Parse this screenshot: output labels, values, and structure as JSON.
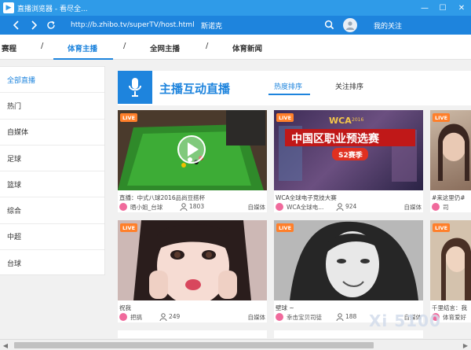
{
  "window": {
    "title": "直播浏览器 - 看尽全..."
  },
  "nav": {
    "url": "http://b.zhibo.tv/superTV/host.html",
    "username": "斯诺克",
    "my_follow": "我的关注"
  },
  "category_tabs": [
    "赛程",
    "体育主播",
    "全网主播",
    "体育新闻"
  ],
  "category_separator": "/",
  "sidebar": {
    "items": [
      "全部直播",
      "热门",
      "自媒体",
      "足球",
      "篮球",
      "综合",
      "中超",
      "台球"
    ]
  },
  "main": {
    "section_title": "主播互动直播",
    "sort_tabs": [
      "热度排序",
      "关注排序"
    ]
  },
  "cards": [
    {
      "badge": "LIVE",
      "caption": "直播：中式八球2016品尚豆搭杯",
      "anchor": "晒小姐_台球",
      "viewers": "1803",
      "tag": "自媒体"
    },
    {
      "badge": "LIVE",
      "caption": "WCA全球电子竞技大赛",
      "anchor": "WCA全球电...",
      "viewers": "924",
      "tag": "自媒体",
      "banner_small": "WCA",
      "banner_year": "2016",
      "banner_main": "中国区职业预选赛",
      "banner_sub": "S2赛季"
    },
    {
      "badge": "LIVE",
      "caption": "#来这里仍#",
      "anchor": "司",
      "viewers": "",
      "tag": ""
    },
    {
      "badge": "LIVE",
      "caption": "祝我",
      "anchor": "把搞",
      "viewers": "249",
      "tag": "自媒体"
    },
    {
      "badge": "LIVE",
      "caption": "壁球 ~",
      "anchor": "幸击宝贝司徒",
      "viewers": "188",
      "tag": "自媒体"
    },
    {
      "badge": "LIVE",
      "caption": "千里结言：我",
      "anchor": "体育爱好",
      "viewers": "",
      "tag": ""
    }
  ],
  "watermark": "Xi 5100"
}
